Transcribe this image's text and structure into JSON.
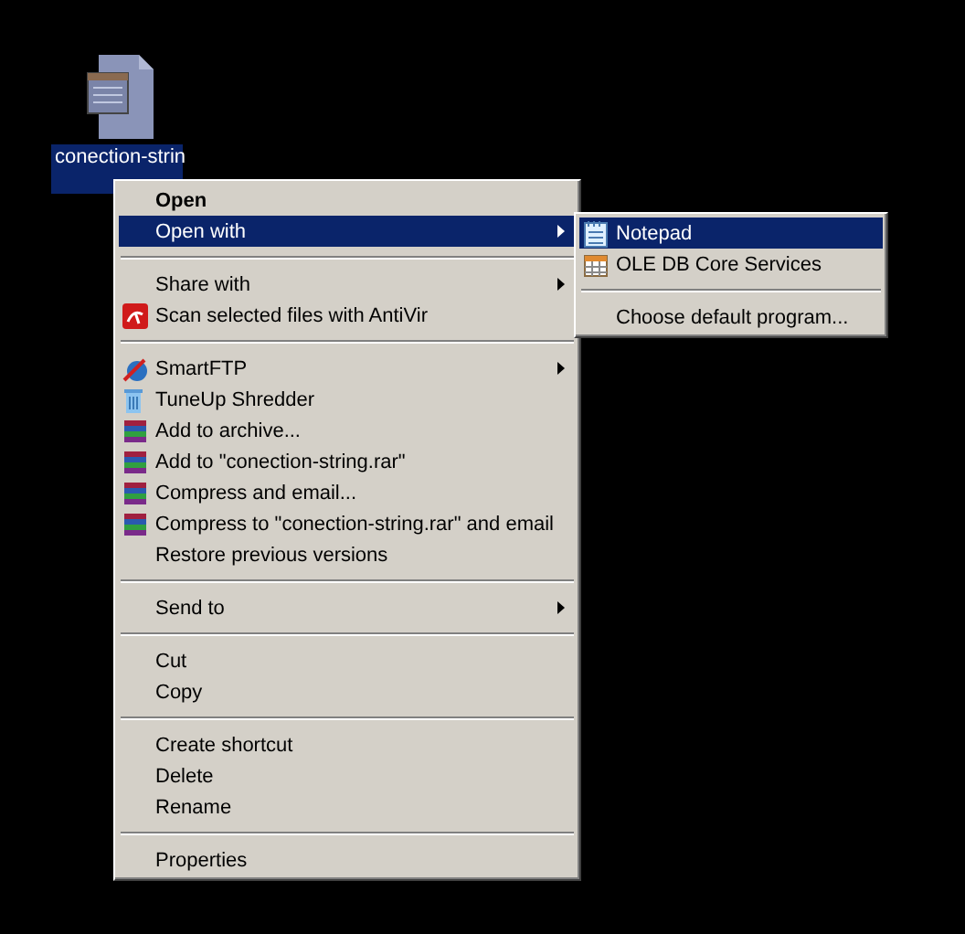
{
  "desktop_icon": {
    "label": "conection-strin",
    "selected": true
  },
  "context_menu": {
    "items": [
      {
        "kind": "plain",
        "label": "Open",
        "bold": true,
        "selected": false,
        "submenu": false
      },
      {
        "kind": "plain",
        "label": "Open with",
        "bold": false,
        "selected": true,
        "submenu": true
      },
      {
        "kind": "separator"
      },
      {
        "kind": "plain",
        "label": "Share with",
        "bold": false,
        "selected": false,
        "submenu": true
      },
      {
        "kind": "antivir",
        "label": "Scan selected files with AntiVir",
        "bold": false,
        "selected": false,
        "submenu": false
      },
      {
        "kind": "separator"
      },
      {
        "kind": "ftp",
        "label": "SmartFTP",
        "bold": false,
        "selected": false,
        "submenu": true
      },
      {
        "kind": "shredder",
        "label": "TuneUp Shredder",
        "bold": false,
        "selected": false,
        "submenu": false
      },
      {
        "kind": "archive",
        "label": "Add to archive...",
        "bold": false,
        "selected": false,
        "submenu": false
      },
      {
        "kind": "archive",
        "label": "Add to \"conection-string.rar\"",
        "bold": false,
        "selected": false,
        "submenu": false
      },
      {
        "kind": "archive",
        "label": "Compress and email...",
        "bold": false,
        "selected": false,
        "submenu": false
      },
      {
        "kind": "archive",
        "label": "Compress to \"conection-string.rar\" and email",
        "bold": false,
        "selected": false,
        "submenu": false
      },
      {
        "kind": "plain",
        "label": "Restore previous versions",
        "bold": false,
        "selected": false,
        "submenu": false
      },
      {
        "kind": "separator"
      },
      {
        "kind": "plain",
        "label": "Send to",
        "bold": false,
        "selected": false,
        "submenu": true
      },
      {
        "kind": "separator"
      },
      {
        "kind": "plain",
        "label": "Cut",
        "bold": false,
        "selected": false,
        "submenu": false
      },
      {
        "kind": "plain",
        "label": "Copy",
        "bold": false,
        "selected": false,
        "submenu": false
      },
      {
        "kind": "separator"
      },
      {
        "kind": "plain",
        "label": "Create shortcut",
        "bold": false,
        "selected": false,
        "submenu": false
      },
      {
        "kind": "plain",
        "label": "Delete",
        "bold": false,
        "selected": false,
        "submenu": false
      },
      {
        "kind": "plain",
        "label": "Rename",
        "bold": false,
        "selected": false,
        "submenu": false
      },
      {
        "kind": "separator"
      },
      {
        "kind": "plain",
        "label": "Properties",
        "bold": false,
        "selected": false,
        "submenu": false
      }
    ]
  },
  "submenu": {
    "items": [
      {
        "kind": "notepad",
        "label": "Notepad",
        "selected": true
      },
      {
        "kind": "oledb",
        "label": "OLE DB Core Services",
        "selected": false
      },
      {
        "kind": "separator"
      },
      {
        "kind": "plain",
        "label": "Choose default program...",
        "selected": false
      }
    ]
  }
}
